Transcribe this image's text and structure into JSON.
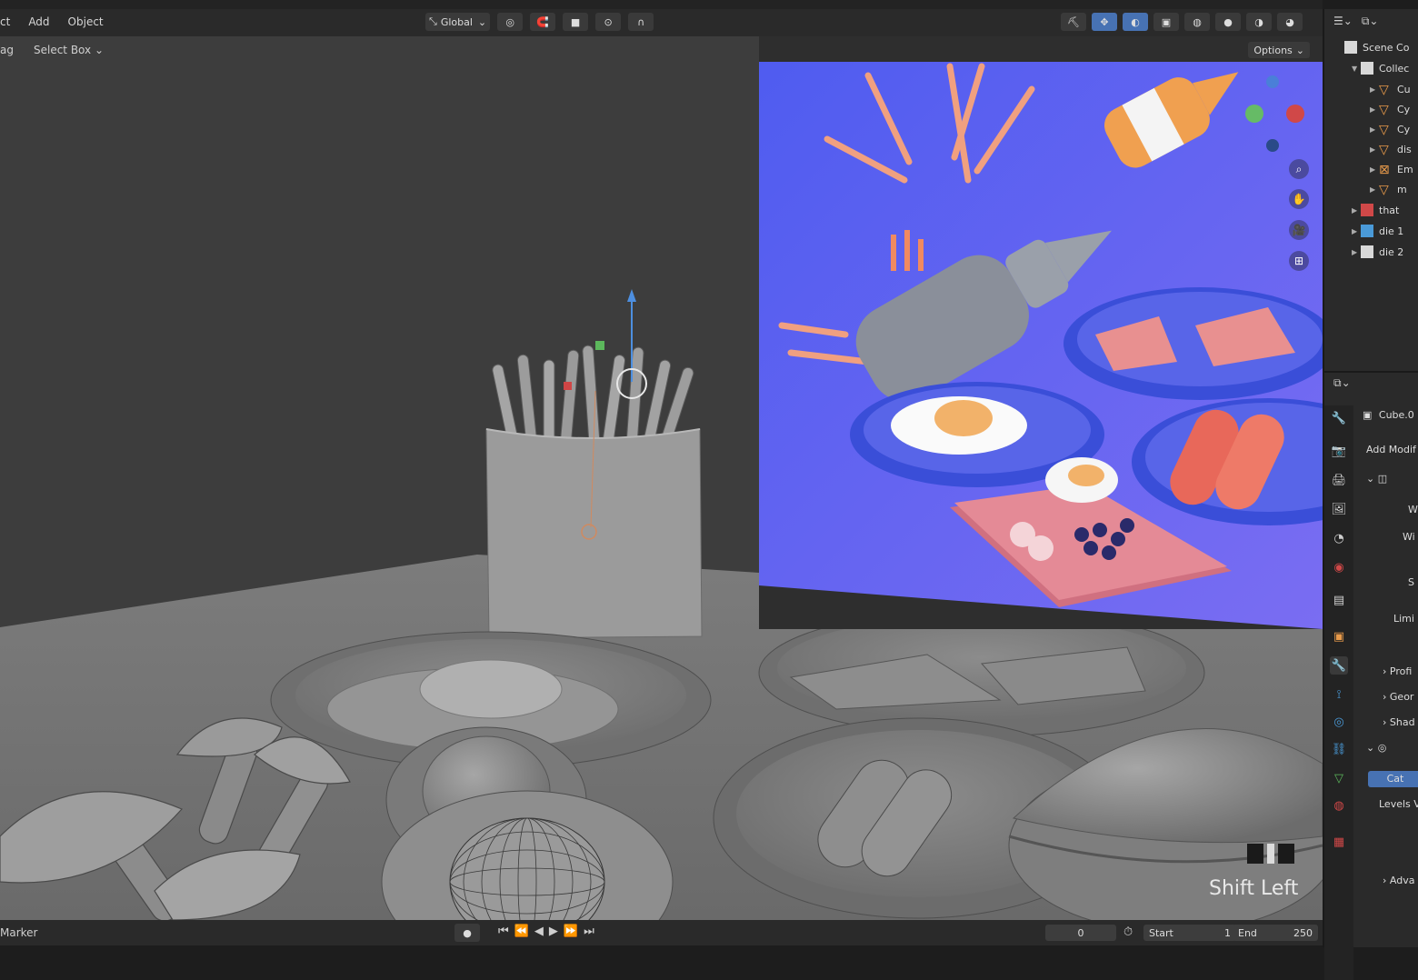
{
  "header": {
    "menu": [
      "ct",
      "Add",
      "Object"
    ],
    "orientation": "Global",
    "options_label": "Options"
  },
  "toolbar": {
    "drag_label": "ag",
    "select_label": "Select Box"
  },
  "outliner": {
    "scene_label": "Scene Co",
    "collection_label": "Collec",
    "items": [
      {
        "label": "Cu",
        "type": "mesh"
      },
      {
        "label": "Cy",
        "type": "mesh"
      },
      {
        "label": "Cy",
        "type": "mesh"
      },
      {
        "label": "dis",
        "type": "mesh"
      },
      {
        "label": "Em",
        "type": "empty"
      },
      {
        "label": "m",
        "type": "mesh"
      }
    ],
    "collections": [
      "that",
      "die 1",
      "die 2"
    ]
  },
  "properties": {
    "object_name": "Cube.0",
    "add_modifier": "Add Modif",
    "fields": [
      "W",
      "Wi",
      "S",
      "Limi"
    ],
    "panels": [
      "Profi",
      "Geor",
      "Shad"
    ],
    "button_label": "Cat",
    "levels_label": "Levels V",
    "advanced_label": "Adva"
  },
  "timeline": {
    "marker_label": "Marker",
    "current_frame": "0",
    "start_label": "Start",
    "start_value": "1",
    "end_label": "End",
    "end_value": "250"
  },
  "overlay": {
    "shortcut_text": "Shift Left"
  },
  "colors": {
    "accent_blue": "#4772b3",
    "viewport_bg": "#3b3b3b",
    "preview_bg": "#5a5ff0"
  }
}
